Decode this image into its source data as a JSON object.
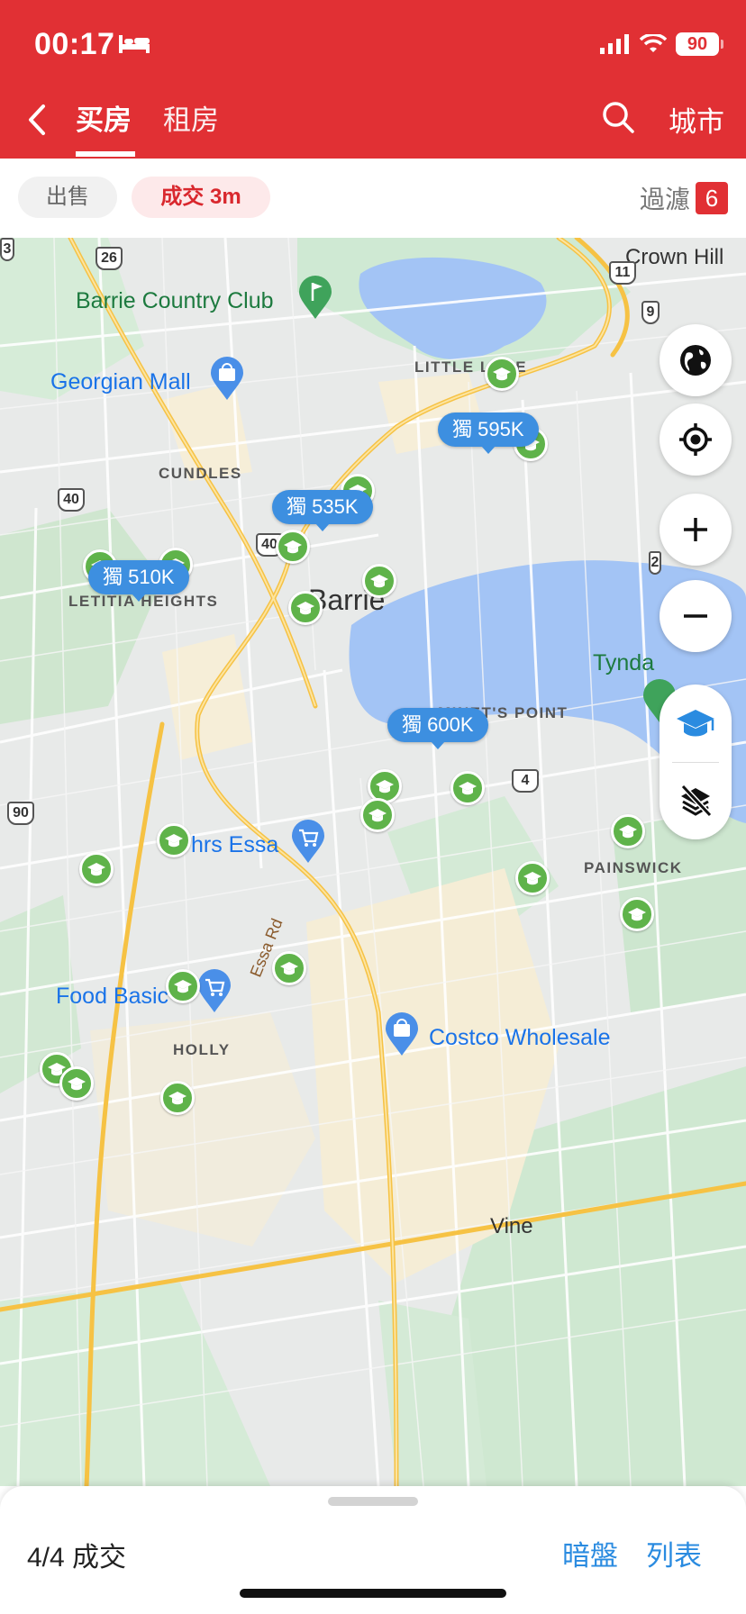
{
  "status_bar": {
    "time": "00:17",
    "battery": "90",
    "icons": [
      "bed-icon",
      "signal-icon",
      "wifi-icon",
      "battery-icon"
    ]
  },
  "nav": {
    "tab_buy": "买房",
    "tab_rent": "租房",
    "city": "城市",
    "active_tab": "买房"
  },
  "filters": {
    "sale_chip": "出售",
    "sold_chip": "成交 3m",
    "filter_label": "過濾",
    "filter_count": "6"
  },
  "map": {
    "places": {
      "crown_hill": "Crown Hill",
      "barrie_country_club": "Barrie Country Club",
      "georgian_mall": "Georgian Mall",
      "little_lake": "LITTLE LAKE",
      "cundles": "CUNDLES",
      "letitia_heights": "LETITIA HEIGHTS",
      "barrie": "Barrie",
      "tyndale": "Tynda",
      "minets_point": "MINET'S POINT",
      "essa": "hrs Essa",
      "painswick": "PAINSWICK",
      "essa_rd": "Essa Rd",
      "food_basics": "Food Basic",
      "holly": "HOLLY",
      "costco": "Costco Wholesale",
      "vine": "Vine"
    },
    "road_shields": {
      "r26": "26",
      "r11": "11",
      "r9": "9",
      "r40a": "40",
      "r40b": "40",
      "r4": "4",
      "r90": "90",
      "r2": "2",
      "r3": "3"
    },
    "price_pins": [
      {
        "label": "獨 595K"
      },
      {
        "label": "獨 535K"
      },
      {
        "label": "獨 510K"
      },
      {
        "label": "獨 600K"
      }
    ],
    "school_count": 22,
    "colors": {
      "water": "#a3c4f5",
      "park": "#cfe9d3",
      "urban": "#f5edd6",
      "road": "#f6c244",
      "pin": "#3d8fe0",
      "school": "#5fb34a"
    }
  },
  "sheet": {
    "count": "4/4 成交",
    "dark_link": "暗盤",
    "list_link": "列表"
  },
  "accent_color": "#e13034"
}
